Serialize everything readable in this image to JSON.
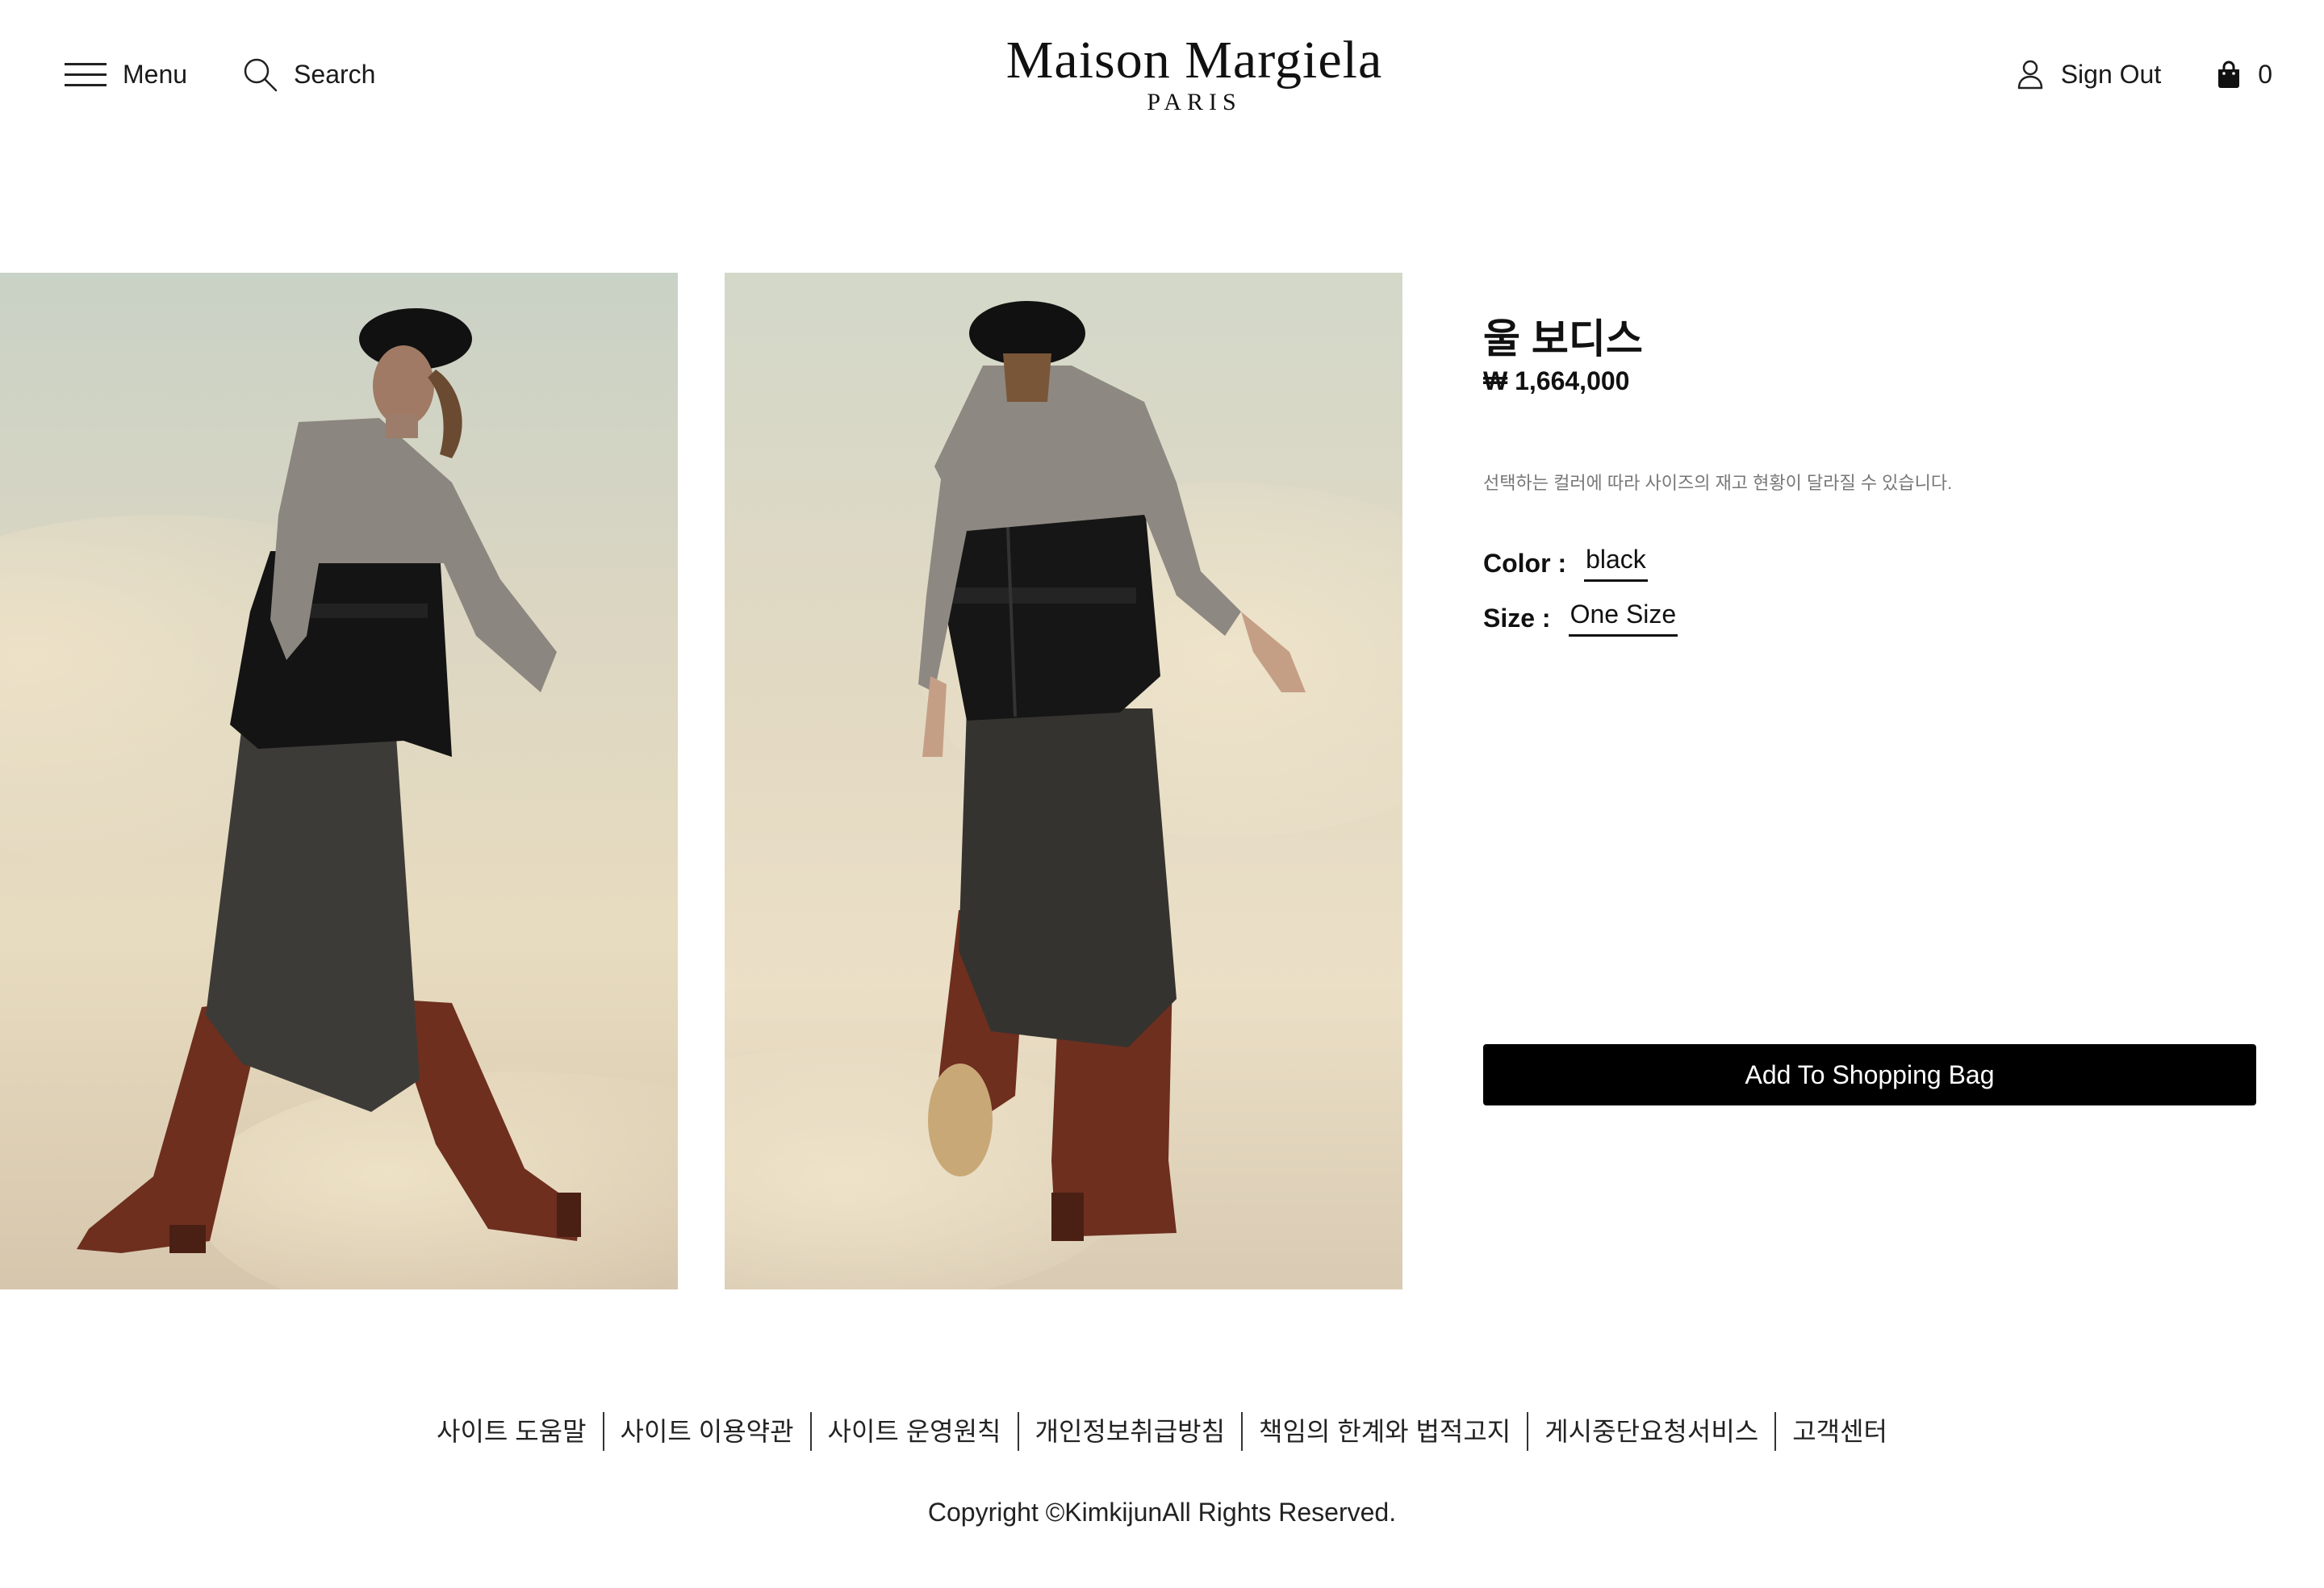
{
  "header": {
    "menu_label": "Menu",
    "search_label": "Search",
    "logo_main": "Maison Margiela",
    "logo_sub": "PARIS",
    "signout_label": "Sign Out",
    "bag_count": "0"
  },
  "gallery": {
    "images": [
      {
        "name": "product-photo-front"
      },
      {
        "name": "product-photo-back"
      }
    ]
  },
  "product": {
    "name": "울 보디스",
    "price": "₩ 1,664,000",
    "stock_note": "선택하는 컬러에 따라 사이즈의 재고 현황이 달라질 수 있습니다.",
    "color_label": "Color :",
    "color_value": "black",
    "size_label": "Size :",
    "size_value": "One Size",
    "add_to_bag_label": "Add To Shopping Bag"
  },
  "footer": {
    "links": [
      "사이트 도움말",
      "사이트 이용약관",
      "사이트 운영원칙",
      "개인정보취급방침",
      "책임의 한계와 법적고지",
      "게시중단요청서비스",
      "고객센터"
    ],
    "copyright": "Copyright ©KimkijunAll Rights Reserved."
  },
  "colors": {
    "button_bg": "#000000",
    "button_text": "#ffffff",
    "text": "#1a1a1a",
    "muted": "#777777"
  }
}
